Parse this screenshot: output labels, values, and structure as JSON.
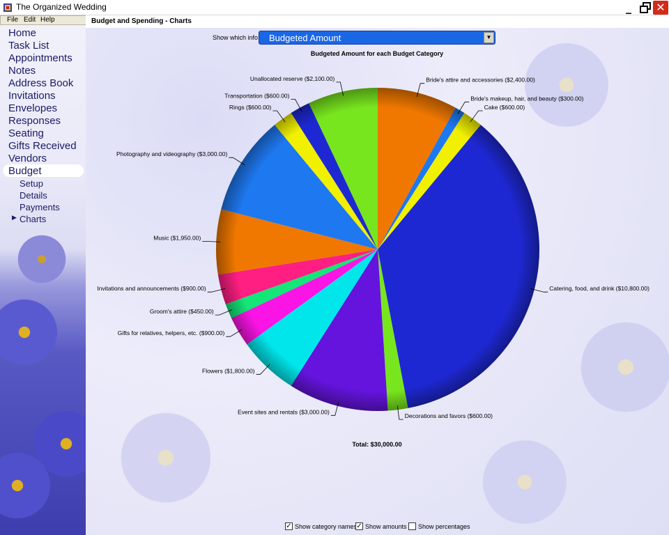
{
  "window": {
    "title": "The Organized Wedding"
  },
  "menu": {
    "file": "File",
    "edit": "Edit",
    "help": "Help"
  },
  "nav": {
    "home": "Home",
    "task_list": "Task List",
    "appointments": "Appointments",
    "notes": "Notes",
    "address_book": "Address Book",
    "invitations": "Invitations",
    "envelopes": "Envelopes",
    "responses": "Responses",
    "seating": "Seating",
    "gifts_received": "Gifts Received",
    "vendors": "Vendors",
    "budget": "Budget",
    "setup": "Setup",
    "details": "Details",
    "payments": "Payments",
    "charts": "Charts"
  },
  "page": {
    "title": "Budget and Spending - Charts"
  },
  "show_info": {
    "label": "Show which info:",
    "selected": "Budgeted Amount"
  },
  "options": {
    "category_names": {
      "label": "Show category names",
      "checked": true
    },
    "amounts": {
      "label": "Show amounts",
      "checked": true
    },
    "percentages": {
      "label": "Show percentages",
      "checked": false
    }
  },
  "chart_data": {
    "type": "pie",
    "title": "Budgeted Amount for each Budget Category",
    "total_label": "Total: $30,000.00",
    "slices": [
      {
        "name": "Bride's attire and accessories",
        "value": 2400,
        "label": "Bride's attire and accessories ($2,400.00)",
        "color": "#f07800"
      },
      {
        "name": "Bride's makeup, hair, and beauty",
        "value": 300,
        "label": "Bride's makeup, hair, and beauty ($300.00)",
        "color": "#1e78f0"
      },
      {
        "name": "Cake",
        "value": 600,
        "label": "Cake ($600.00)",
        "color": "#f0f000"
      },
      {
        "name": "Catering, food, and drink",
        "value": 10800,
        "label": "Catering, food, and drink ($10,800.00)",
        "color": "#1e28d2"
      },
      {
        "name": "Decorations and favors",
        "value": 600,
        "label": "Decorations and favors ($600.00)",
        "color": "#78e61e"
      },
      {
        "name": "Event sites and rentals",
        "value": 3000,
        "label": "Event sites and rentals ($3,000.00)",
        "color": "#6414dc"
      },
      {
        "name": "Flowers",
        "value": 1800,
        "label": "Flowers ($1,800.00)",
        "color": "#00e6eb"
      },
      {
        "name": "Gifts for relatives, helpers, etc.",
        "value": 900,
        "label": "Gifts for relatives, helpers, etc. ($900.00)",
        "color": "#fa14e6"
      },
      {
        "name": "Groom's attire",
        "value": 450,
        "label": "Groom's attire ($450.00)",
        "color": "#14e678"
      },
      {
        "name": "Invitations and announcements",
        "value": 900,
        "label": "Invitations and announcements ($900.00)",
        "color": "#ff1e82"
      },
      {
        "name": "Music",
        "value": 1950,
        "label": "Music ($1,950.00)",
        "color": "#f07800"
      },
      {
        "name": "Photography and videography",
        "value": 3000,
        "label": "Photography and videography ($3,000.00)",
        "color": "#1e78f0"
      },
      {
        "name": "Rings",
        "value": 600,
        "label": "Rings ($600.00)",
        "color": "#f0f000"
      },
      {
        "name": "Transportation",
        "value": 600,
        "label": "Transportation ($600.00)",
        "color": "#1e28d2"
      },
      {
        "name": "Unallocated reserve",
        "value": 2100,
        "label": "Unallocated reserve ($2,100.00)",
        "color": "#78e61e"
      }
    ]
  }
}
